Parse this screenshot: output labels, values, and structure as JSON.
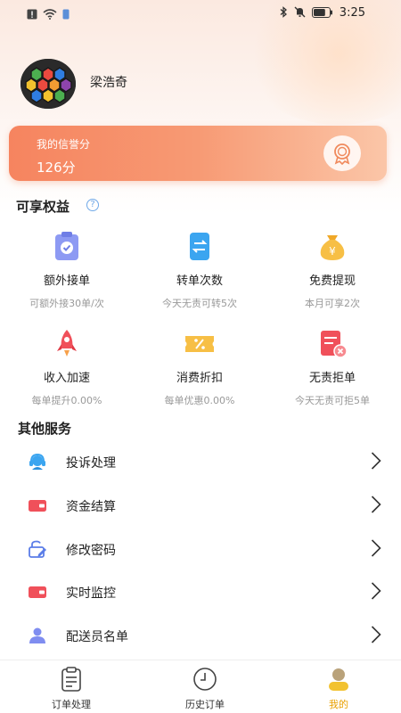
{
  "status_bar": {
    "time": "3:25",
    "battery_level": 0.75
  },
  "profile": {
    "name": "梁浩奇"
  },
  "credit": {
    "label": "我的信誉分",
    "value": "126分"
  },
  "benefits_section": {
    "title": "可享权益",
    "items": [
      {
        "name": "额外接单",
        "desc": "可额外接30单/次",
        "icon": "clipboard-check-icon",
        "color": "#7f8df0"
      },
      {
        "name": "转单次数",
        "desc": "今天无责可转5次",
        "icon": "transfer-card-icon",
        "color": "#3ba5f0"
      },
      {
        "name": "免费提现",
        "desc": "本月可享2次",
        "icon": "money-bag-icon",
        "color": "#f5b63a"
      },
      {
        "name": "收入加速",
        "desc": "每单提升0.00%",
        "icon": "rocket-icon",
        "color": "#f0505a"
      },
      {
        "name": "消费折扣",
        "desc": "每单优惠0.00%",
        "icon": "discount-ticket-icon",
        "color": "#f5b63a"
      },
      {
        "name": "无责拒单",
        "desc": "今天无责可拒5单",
        "icon": "reject-doc-icon",
        "color": "#f0505a"
      }
    ]
  },
  "services_section": {
    "title": "其他服务",
    "items": [
      {
        "label": "投诉处理",
        "icon": "customer-service-icon"
      },
      {
        "label": "资金结算",
        "icon": "wallet-icon"
      },
      {
        "label": "修改密码",
        "icon": "lock-edit-icon"
      },
      {
        "label": "实时监控",
        "icon": "monitor-wallet-icon"
      },
      {
        "label": "配送员名单",
        "icon": "person-icon"
      }
    ]
  },
  "bottom_nav": {
    "items": [
      {
        "label": "订单处理",
        "icon": "order-clipboard-icon"
      },
      {
        "label": "历史订单",
        "icon": "clock-icon"
      },
      {
        "label": "我的",
        "icon": "profile-icon",
        "active": true
      }
    ]
  }
}
